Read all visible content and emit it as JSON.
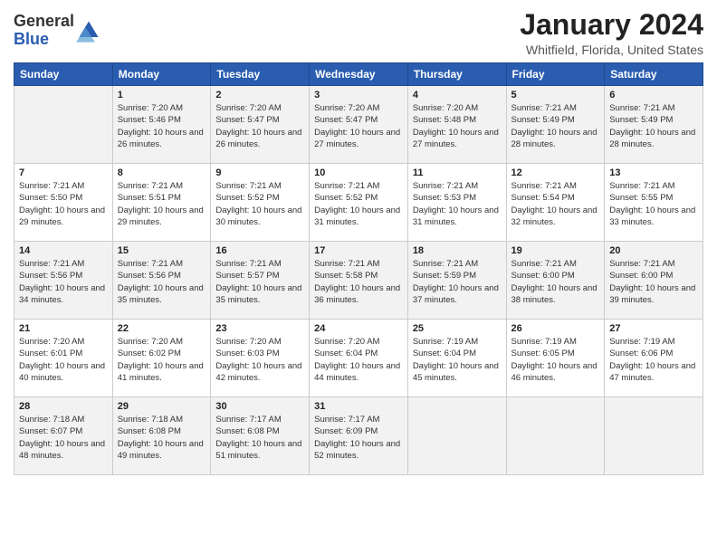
{
  "header": {
    "logo_general": "General",
    "logo_blue": "Blue",
    "month_title": "January 2024",
    "subtitle": "Whitfield, Florida, United States"
  },
  "weekdays": [
    "Sunday",
    "Monday",
    "Tuesday",
    "Wednesday",
    "Thursday",
    "Friday",
    "Saturday"
  ],
  "weeks": [
    [
      {
        "day": "",
        "sunrise": "",
        "sunset": "",
        "daylight": ""
      },
      {
        "day": "1",
        "sunrise": "Sunrise: 7:20 AM",
        "sunset": "Sunset: 5:46 PM",
        "daylight": "Daylight: 10 hours and 26 minutes."
      },
      {
        "day": "2",
        "sunrise": "Sunrise: 7:20 AM",
        "sunset": "Sunset: 5:47 PM",
        "daylight": "Daylight: 10 hours and 26 minutes."
      },
      {
        "day": "3",
        "sunrise": "Sunrise: 7:20 AM",
        "sunset": "Sunset: 5:47 PM",
        "daylight": "Daylight: 10 hours and 27 minutes."
      },
      {
        "day": "4",
        "sunrise": "Sunrise: 7:20 AM",
        "sunset": "Sunset: 5:48 PM",
        "daylight": "Daylight: 10 hours and 27 minutes."
      },
      {
        "day": "5",
        "sunrise": "Sunrise: 7:21 AM",
        "sunset": "Sunset: 5:49 PM",
        "daylight": "Daylight: 10 hours and 28 minutes."
      },
      {
        "day": "6",
        "sunrise": "Sunrise: 7:21 AM",
        "sunset": "Sunset: 5:49 PM",
        "daylight": "Daylight: 10 hours and 28 minutes."
      }
    ],
    [
      {
        "day": "7",
        "sunrise": "Sunrise: 7:21 AM",
        "sunset": "Sunset: 5:50 PM",
        "daylight": "Daylight: 10 hours and 29 minutes."
      },
      {
        "day": "8",
        "sunrise": "Sunrise: 7:21 AM",
        "sunset": "Sunset: 5:51 PM",
        "daylight": "Daylight: 10 hours and 29 minutes."
      },
      {
        "day": "9",
        "sunrise": "Sunrise: 7:21 AM",
        "sunset": "Sunset: 5:52 PM",
        "daylight": "Daylight: 10 hours and 30 minutes."
      },
      {
        "day": "10",
        "sunrise": "Sunrise: 7:21 AM",
        "sunset": "Sunset: 5:52 PM",
        "daylight": "Daylight: 10 hours and 31 minutes."
      },
      {
        "day": "11",
        "sunrise": "Sunrise: 7:21 AM",
        "sunset": "Sunset: 5:53 PM",
        "daylight": "Daylight: 10 hours and 31 minutes."
      },
      {
        "day": "12",
        "sunrise": "Sunrise: 7:21 AM",
        "sunset": "Sunset: 5:54 PM",
        "daylight": "Daylight: 10 hours and 32 minutes."
      },
      {
        "day": "13",
        "sunrise": "Sunrise: 7:21 AM",
        "sunset": "Sunset: 5:55 PM",
        "daylight": "Daylight: 10 hours and 33 minutes."
      }
    ],
    [
      {
        "day": "14",
        "sunrise": "Sunrise: 7:21 AM",
        "sunset": "Sunset: 5:56 PM",
        "daylight": "Daylight: 10 hours and 34 minutes."
      },
      {
        "day": "15",
        "sunrise": "Sunrise: 7:21 AM",
        "sunset": "Sunset: 5:56 PM",
        "daylight": "Daylight: 10 hours and 35 minutes."
      },
      {
        "day": "16",
        "sunrise": "Sunrise: 7:21 AM",
        "sunset": "Sunset: 5:57 PM",
        "daylight": "Daylight: 10 hours and 35 minutes."
      },
      {
        "day": "17",
        "sunrise": "Sunrise: 7:21 AM",
        "sunset": "Sunset: 5:58 PM",
        "daylight": "Daylight: 10 hours and 36 minutes."
      },
      {
        "day": "18",
        "sunrise": "Sunrise: 7:21 AM",
        "sunset": "Sunset: 5:59 PM",
        "daylight": "Daylight: 10 hours and 37 minutes."
      },
      {
        "day": "19",
        "sunrise": "Sunrise: 7:21 AM",
        "sunset": "Sunset: 6:00 PM",
        "daylight": "Daylight: 10 hours and 38 minutes."
      },
      {
        "day": "20",
        "sunrise": "Sunrise: 7:21 AM",
        "sunset": "Sunset: 6:00 PM",
        "daylight": "Daylight: 10 hours and 39 minutes."
      }
    ],
    [
      {
        "day": "21",
        "sunrise": "Sunrise: 7:20 AM",
        "sunset": "Sunset: 6:01 PM",
        "daylight": "Daylight: 10 hours and 40 minutes."
      },
      {
        "day": "22",
        "sunrise": "Sunrise: 7:20 AM",
        "sunset": "Sunset: 6:02 PM",
        "daylight": "Daylight: 10 hours and 41 minutes."
      },
      {
        "day": "23",
        "sunrise": "Sunrise: 7:20 AM",
        "sunset": "Sunset: 6:03 PM",
        "daylight": "Daylight: 10 hours and 42 minutes."
      },
      {
        "day": "24",
        "sunrise": "Sunrise: 7:20 AM",
        "sunset": "Sunset: 6:04 PM",
        "daylight": "Daylight: 10 hours and 44 minutes."
      },
      {
        "day": "25",
        "sunrise": "Sunrise: 7:19 AM",
        "sunset": "Sunset: 6:04 PM",
        "daylight": "Daylight: 10 hours and 45 minutes."
      },
      {
        "day": "26",
        "sunrise": "Sunrise: 7:19 AM",
        "sunset": "Sunset: 6:05 PM",
        "daylight": "Daylight: 10 hours and 46 minutes."
      },
      {
        "day": "27",
        "sunrise": "Sunrise: 7:19 AM",
        "sunset": "Sunset: 6:06 PM",
        "daylight": "Daylight: 10 hours and 47 minutes."
      }
    ],
    [
      {
        "day": "28",
        "sunrise": "Sunrise: 7:18 AM",
        "sunset": "Sunset: 6:07 PM",
        "daylight": "Daylight: 10 hours and 48 minutes."
      },
      {
        "day": "29",
        "sunrise": "Sunrise: 7:18 AM",
        "sunset": "Sunset: 6:08 PM",
        "daylight": "Daylight: 10 hours and 49 minutes."
      },
      {
        "day": "30",
        "sunrise": "Sunrise: 7:17 AM",
        "sunset": "Sunset: 6:08 PM",
        "daylight": "Daylight: 10 hours and 51 minutes."
      },
      {
        "day": "31",
        "sunrise": "Sunrise: 7:17 AM",
        "sunset": "Sunset: 6:09 PM",
        "daylight": "Daylight: 10 hours and 52 minutes."
      },
      {
        "day": "",
        "sunrise": "",
        "sunset": "",
        "daylight": ""
      },
      {
        "day": "",
        "sunrise": "",
        "sunset": "",
        "daylight": ""
      },
      {
        "day": "",
        "sunrise": "",
        "sunset": "",
        "daylight": ""
      }
    ]
  ]
}
